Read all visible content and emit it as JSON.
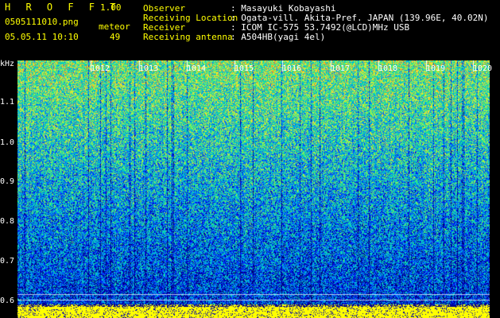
{
  "header": {
    "app_title": "H R O F F T",
    "version": "1.00",
    "file_name": "0505111010.png",
    "event_type": "meteor",
    "timestamp": "05.05.11 10:10",
    "count": "49",
    "fields": [
      {
        "label": "Observer",
        "value": ": Masayuki Kobayashi"
      },
      {
        "label": "Receiving Location",
        "value": ": Ogata-vill. Akita-Pref. JAPAN (139.96E, 40.02N)"
      },
      {
        "label": "Receiver",
        "value": ": ICOM IC-575 53.7492(@LCD)MHz USB"
      },
      {
        "label": "Receiving antenna",
        "value": ": A504HB(yagi 4el)"
      }
    ]
  },
  "axis": {
    "y_unit": "kHz",
    "y_ticks": [
      "1.1",
      "1.0",
      "0.9",
      "0.8",
      "0.7",
      "0.6"
    ],
    "x_ticks": [
      "1012",
      "1013",
      "1014",
      "1015",
      "1016",
      "1017",
      "1018",
      "1019",
      "1020"
    ]
  },
  "colors": {
    "header_text": "#ffff00",
    "header_value": "#ffffff",
    "background": "#000000",
    "baseline": "#ffff00"
  }
}
